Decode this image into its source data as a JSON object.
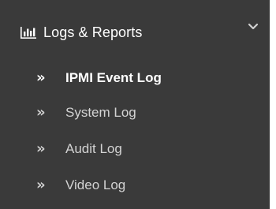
{
  "section": {
    "title": "Logs & Reports",
    "icon": "bar-chart-icon",
    "toggle_icon": "chevron-down-icon",
    "expanded": true
  },
  "colors": {
    "panel_background": "#3a3a3a",
    "active_text": "#ffffff",
    "inactive_text": "#d3d3d3"
  },
  "menu": {
    "items": [
      {
        "label": "IPMI Event Log",
        "bullet": "»",
        "active": true
      },
      {
        "label": "System Log",
        "bullet": "»",
        "active": false
      },
      {
        "label": "Audit Log",
        "bullet": "»",
        "active": false
      },
      {
        "label": "Video Log",
        "bullet": "»",
        "active": false
      }
    ]
  }
}
